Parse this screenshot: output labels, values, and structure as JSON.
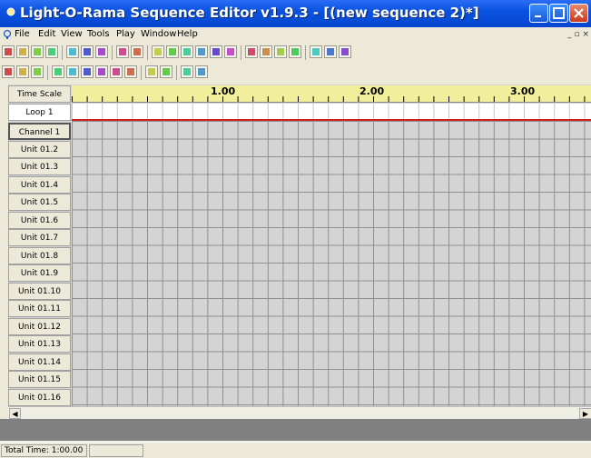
{
  "window": {
    "title": "Light-O-Rama Sequence Editor v1.9.3 - [(new sequence 2)*]"
  },
  "menu": [
    {
      "label": "File"
    },
    {
      "label": "Edit"
    },
    {
      "label": "View"
    },
    {
      "label": "Tools"
    },
    {
      "label": "Play"
    },
    {
      "label": "Window"
    },
    {
      "label": "Help"
    }
  ],
  "mdi_controls": "_ ▫ ×",
  "toolbar1": [
    {
      "name": "new-icon"
    },
    {
      "name": "open-icon"
    },
    {
      "name": "open-folder-icon"
    },
    {
      "name": "save-icon"
    },
    {
      "name": "cut-icon"
    },
    {
      "name": "copy-icon"
    },
    {
      "name": "paste-icon"
    },
    {
      "name": "undo-icon"
    },
    {
      "name": "redo-icon"
    },
    {
      "name": "intensity-icon"
    },
    {
      "name": "fade-icon"
    },
    {
      "name": "grid-icon"
    },
    {
      "name": "color-icon"
    },
    {
      "name": "timer-icon"
    },
    {
      "name": "snap-icon"
    },
    {
      "name": "zoom-in-icon"
    },
    {
      "name": "zoom-out-icon"
    },
    {
      "name": "zoom-fit-icon"
    },
    {
      "name": "zoom-sel-icon"
    },
    {
      "name": "play-icon"
    },
    {
      "name": "play-from-icon"
    },
    {
      "name": "stop-icon"
    }
  ],
  "toolbar2": [
    {
      "name": "pointer-tool-icon"
    },
    {
      "name": "select-tool-icon"
    },
    {
      "name": "sparkle-tool-icon"
    },
    {
      "name": "on-tool-icon"
    },
    {
      "name": "off-tool-icon"
    },
    {
      "name": "shimmer-tool-icon"
    },
    {
      "name": "ramp-up-icon"
    },
    {
      "name": "ramp-down-icon"
    },
    {
      "name": "twinkle-icon"
    },
    {
      "name": "copy-row-icon"
    },
    {
      "name": "paste-row-icon"
    },
    {
      "name": "chart-up-icon"
    },
    {
      "name": "chart-down-icon"
    }
  ],
  "grid": {
    "time_scale_label": "Time Scale",
    "loop_label": "Loop 1",
    "ruler_marks": [
      "1.00",
      "2.00",
      "3.00"
    ],
    "channels": [
      "Channel 1",
      "Unit 01.2",
      "Unit 01.3",
      "Unit 01.4",
      "Unit 01.5",
      "Unit 01.6",
      "Unit 01.7",
      "Unit 01.8",
      "Unit 01.9",
      "Unit 01.10",
      "Unit 01.11",
      "Unit 01.12",
      "Unit 01.13",
      "Unit 01.14",
      "Unit 01.15",
      "Unit 01.16"
    ]
  },
  "status": {
    "total_time": "Total Time: 1:00.00"
  }
}
